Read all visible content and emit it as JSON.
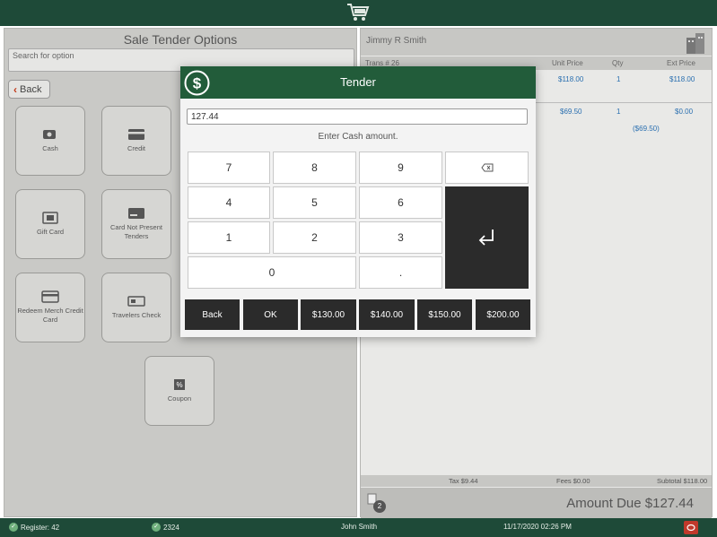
{
  "topbar": {
    "cart_icon": "shopping-cart-icon"
  },
  "left": {
    "title": "Sale Tender Options",
    "search_placeholder": "Search for option",
    "back_label": "Back",
    "tiles": [
      {
        "label": "Cash",
        "icon": "cash-icon"
      },
      {
        "label": "Credit",
        "icon": "credit-card-icon"
      },
      {
        "label": "Gift Card",
        "icon": "gift-card-icon"
      },
      {
        "label": "Card Not Present Tenders",
        "icon": "card-not-present-icon"
      },
      {
        "label": "Redeem Merch Credit Card",
        "icon": "merch-credit-icon"
      },
      {
        "label": "Travelers Check",
        "icon": "travelers-check-icon"
      },
      {
        "label": "Coupon",
        "icon": "coupon-icon"
      }
    ]
  },
  "right": {
    "customer_name": "Jimmy R Smith",
    "header": {
      "trans": "Trans # 26",
      "unit_price": "Unit Price",
      "qty": "Qty",
      "ext_price": "Ext Price"
    },
    "lines": [
      {
        "unit_price": "$118.00",
        "qty": "1",
        "ext_price": "$118.00",
        "discount": ""
      },
      {
        "unit_price": "$69.50",
        "qty": "1",
        "ext_price": "$0.00",
        "discount": "($69.50)"
      }
    ],
    "totals": {
      "tax": "Tax $9.44",
      "fees": "Fees $0.00",
      "subtotal": "Subtotal $118.00"
    },
    "receipt_count": "2",
    "amount_due": "Amount Due  $127.44"
  },
  "modal": {
    "title": "Tender",
    "icon": "dollar-icon",
    "amount_value": "127.44",
    "prompt": "Enter Cash amount.",
    "keys": [
      "7",
      "8",
      "9",
      "4",
      "5",
      "6",
      "1",
      "2",
      "3",
      "0",
      "."
    ],
    "backspace_icon": "backspace-icon",
    "enter_icon": "enter-icon",
    "actions": [
      "Back",
      "OK",
      "$130.00",
      "$140.00",
      "$150.00",
      "$200.00"
    ]
  },
  "status": {
    "register": "Register: 42",
    "id": "2324",
    "user": "John Smith",
    "datetime": "11/17/2020 02:26 PM"
  },
  "colors": {
    "header_green": "#1e4a38",
    "modal_green": "#225c3a",
    "key_dark": "#2b2b2b",
    "link_blue": "#2a6fb0"
  }
}
